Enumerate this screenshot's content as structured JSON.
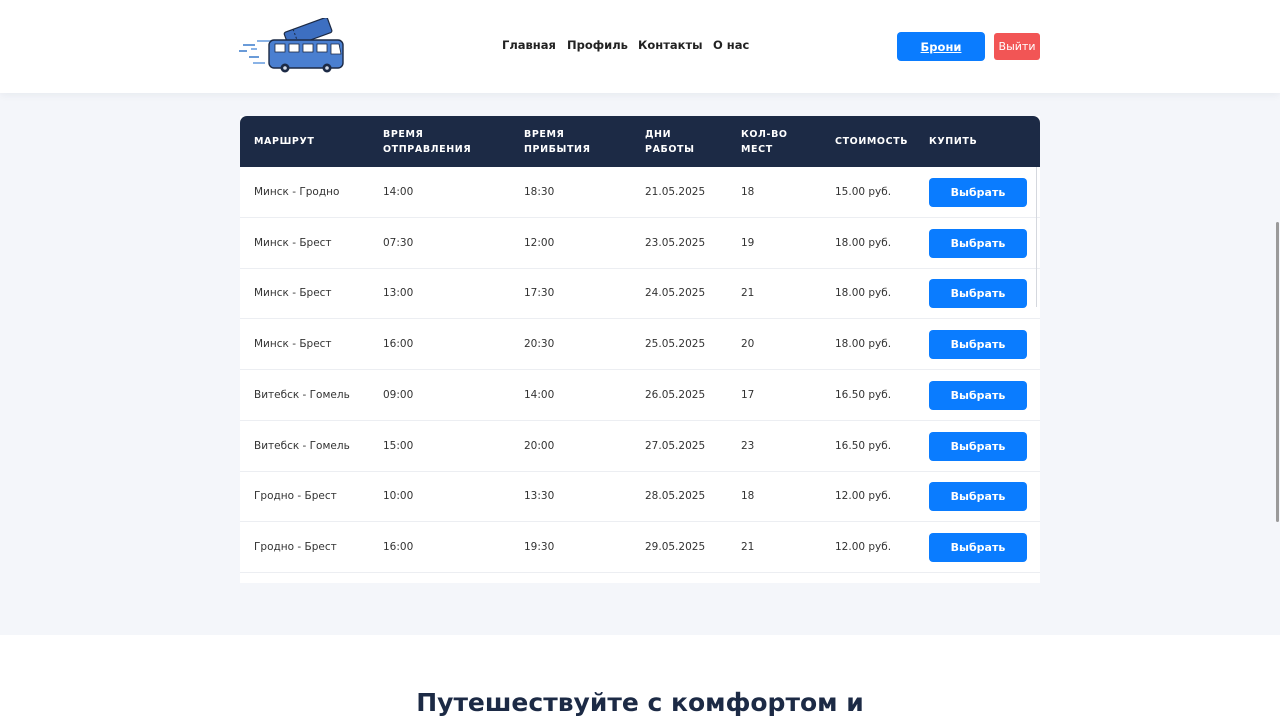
{
  "nav": {
    "home": "Главная",
    "profile": "Профиль",
    "contacts": "Контакты",
    "about": "О нас",
    "bookings": "Брони",
    "logout": "Выйти"
  },
  "colors": {
    "primary": "#0a7cff",
    "danger": "#f25555",
    "header_dark": "#1c2a45"
  },
  "table": {
    "headers": {
      "route": "МАРШРУТ",
      "departure_1": "ВРЕМЯ",
      "departure_2": "ОТПРАВЛЕНИЯ",
      "arrival_1": "ВРЕМЯ",
      "arrival_2": "ПРИБЫТИЯ",
      "days_1": "ДНИ",
      "days_2": "РАБОТЫ",
      "seats_1": "КОЛ-ВО",
      "seats_2": "МЕСТ",
      "price": "СТОИМОСТЬ",
      "buy": "КУПИТЬ"
    },
    "select_label": "Выбрать",
    "rows": [
      {
        "route": "Минск - Гродно",
        "departure": "14:00",
        "arrival": "18:30",
        "date": "21.05.2025",
        "seats": "18",
        "price": "15.00 руб."
      },
      {
        "route": "Минск - Брест",
        "departure": "07:30",
        "arrival": "12:00",
        "date": "23.05.2025",
        "seats": "19",
        "price": "18.00 руб."
      },
      {
        "route": "Минск - Брест",
        "departure": "13:00",
        "arrival": "17:30",
        "date": "24.05.2025",
        "seats": "21",
        "price": "18.00 руб."
      },
      {
        "route": "Минск - Брест",
        "departure": "16:00",
        "arrival": "20:30",
        "date": "25.05.2025",
        "seats": "20",
        "price": "18.00 руб."
      },
      {
        "route": "Витебск - Гомель",
        "departure": "09:00",
        "arrival": "14:00",
        "date": "26.05.2025",
        "seats": "17",
        "price": "16.50 руб."
      },
      {
        "route": "Витебск - Гомель",
        "departure": "15:00",
        "arrival": "20:00",
        "date": "27.05.2025",
        "seats": "23",
        "price": "16.50 руб."
      },
      {
        "route": "Гродно - Брест",
        "departure": "10:00",
        "arrival": "13:30",
        "date": "28.05.2025",
        "seats": "18",
        "price": "12.00 руб."
      },
      {
        "route": "Гродно - Брест",
        "departure": "16:00",
        "arrival": "19:30",
        "date": "29.05.2025",
        "seats": "21",
        "price": "12.00 руб."
      }
    ]
  },
  "promo": {
    "title": "Путешествуйте с комфортом и"
  }
}
